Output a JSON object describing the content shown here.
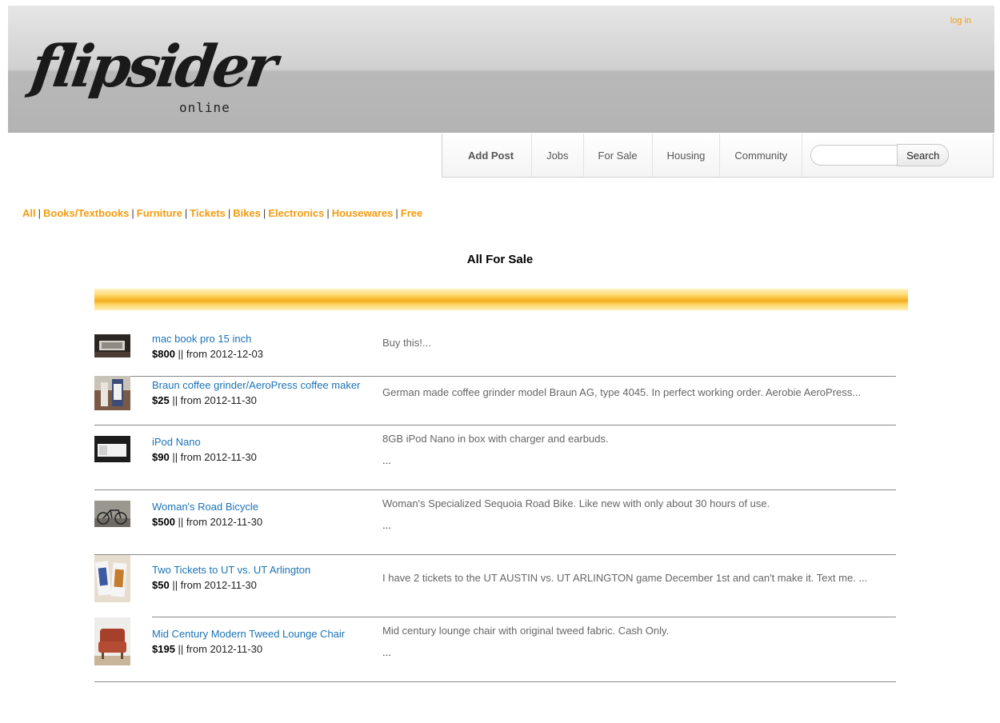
{
  "header": {
    "login_label": "log in",
    "logo_word": "flipsider",
    "logo_sub": "online"
  },
  "nav": {
    "items": [
      "Add Post",
      "Jobs",
      "For Sale",
      "Housing",
      "Community"
    ],
    "search_placeholder": "",
    "search_value": "",
    "search_button": "Search"
  },
  "categories": [
    "All",
    "Books/Textbooks",
    "Furniture",
    "Tickets",
    "Bikes",
    "Electronics",
    "Housewares",
    "Free"
  ],
  "category_separator": "|",
  "page_title": "All For Sale",
  "listings": [
    {
      "title": "mac book pro 15 inch",
      "price": "$800",
      "meta": " || from 2012-12-03",
      "desc": "Buy this!...",
      "more": ""
    },
    {
      "title": "Braun coffee grinder/AeroPress coffee maker",
      "price": "$25",
      "meta": " || from 2012-11-30",
      "desc": "German made coffee grinder model Braun AG, type 4045. In perfect working order. Aerobie AeroPress...",
      "more": ""
    },
    {
      "title": "iPod Nano",
      "price": "$90",
      "meta": " || from 2012-11-30",
      "desc": "8GB iPod Nano in box with charger and earbuds.",
      "more": "..."
    },
    {
      "title": "Woman's Road Bicycle",
      "price": "$500",
      "meta": " || from 2012-11-30",
      "desc": "Woman's Specialized Sequoia Road Bike. Like new with only about 30 hours of use.",
      "more": "..."
    },
    {
      "title": "Two Tickets to UT vs. UT Arlington",
      "price": "$50",
      "meta": " || from 2012-11-30",
      "desc": "I have 2 tickets to the UT AUSTIN vs. UT ARLINGTON game December 1st and can't make it. Text me. ...",
      "more": ""
    },
    {
      "title": "Mid Century Modern Tweed Lounge Chair",
      "price": "$195",
      "meta": " || from 2012-11-30",
      "desc": "Mid century lounge chair with original tweed fabric. Cash Only.",
      "more": "..."
    }
  ],
  "colors": {
    "accent_orange": "#f39c12",
    "link_blue": "#1a73b5"
  }
}
